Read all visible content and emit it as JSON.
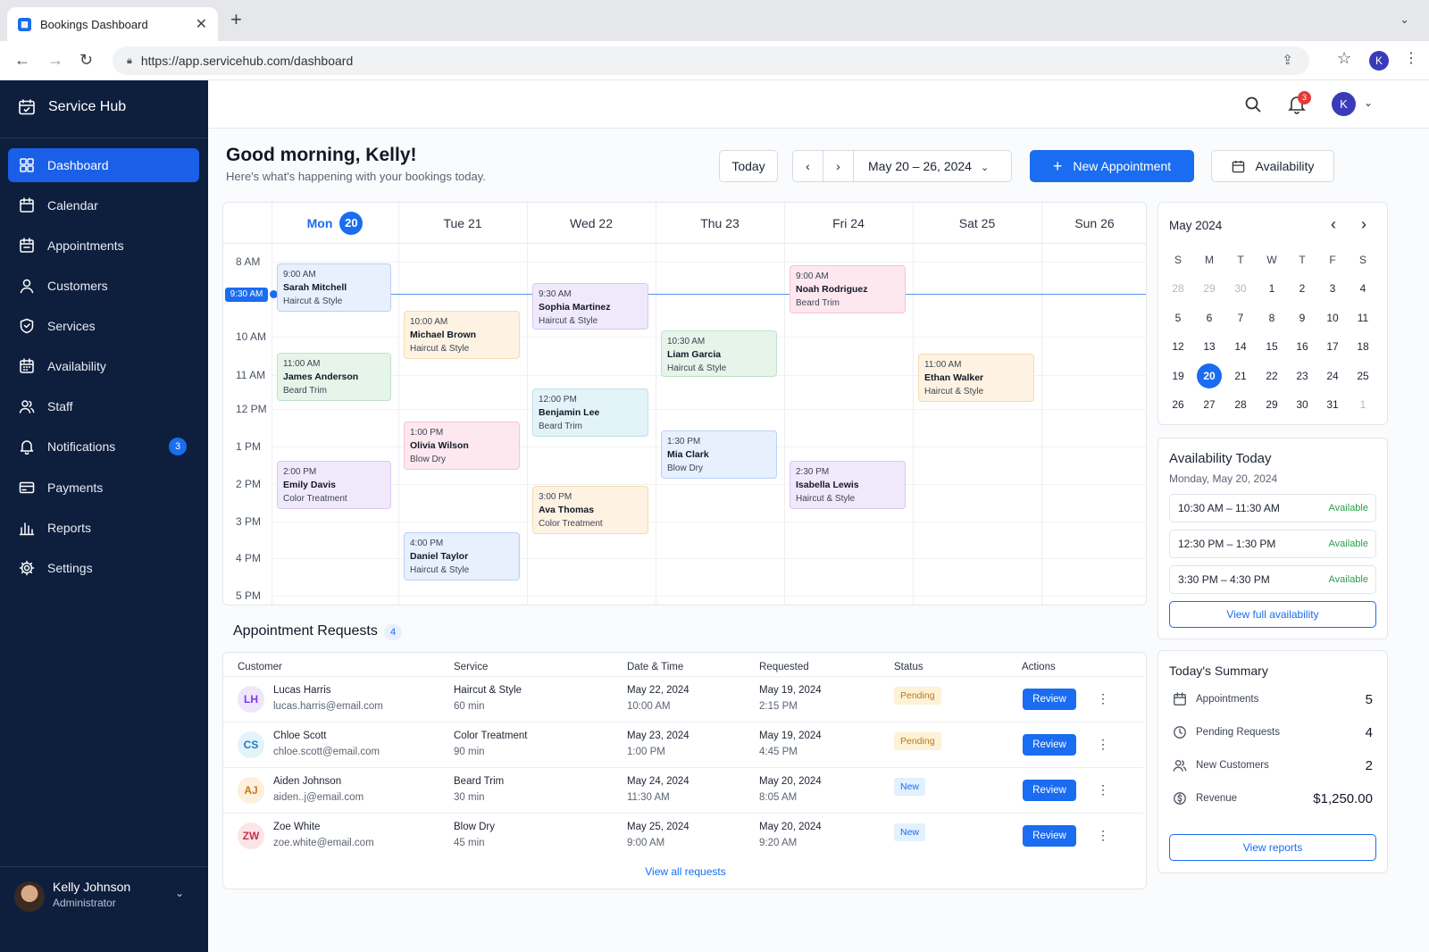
{
  "browser": {
    "tab_title": "Bookings Dashboard",
    "url": "https://app.servicehub.com/dashboard",
    "profile_initial": "K"
  },
  "sidebar": {
    "brand": "Service Hub",
    "items": [
      {
        "label": "Dashboard",
        "icon": "grid-icon"
      },
      {
        "label": "Calendar",
        "icon": "calendar-icon"
      },
      {
        "label": "Appointments",
        "icon": "calendar-check-icon"
      },
      {
        "label": "Customers",
        "icon": "user-icon"
      },
      {
        "label": "Services",
        "icon": "heart-shield-icon"
      },
      {
        "label": "Availability",
        "icon": "calendar-grid-icon"
      },
      {
        "label": "Staff",
        "icon": "users-icon"
      },
      {
        "label": "Notifications",
        "icon": "bell-icon",
        "badge": "3"
      },
      {
        "label": "Payments",
        "icon": "card-icon"
      },
      {
        "label": "Reports",
        "icon": "bar-chart-icon"
      },
      {
        "label": "Settings",
        "icon": "gear-icon"
      }
    ],
    "user": {
      "name": "Kelly Johnson",
      "role": "Administrator"
    }
  },
  "topbar": {
    "notification_count": "3",
    "avatar_initial": "K"
  },
  "header": {
    "greeting": "Good morning, Kelly!",
    "subtitle": "Here's what's happening with your bookings today.",
    "today_label": "Today",
    "range": "May 20 – 26, 2024",
    "new_appointment": "New Appointment",
    "availability": "Availability"
  },
  "calendar": {
    "days": [
      {
        "name": "Mon",
        "num": "20"
      },
      {
        "label": "Tue 21"
      },
      {
        "label": "Wed 22"
      },
      {
        "label": "Thu 23"
      },
      {
        "label": "Fri 24"
      },
      {
        "label": "Sat 25"
      },
      {
        "label": "Sun 26"
      }
    ],
    "times": [
      "8 AM",
      "10 AM",
      "11 AM",
      "12 PM",
      "1 PM",
      "2 PM",
      "3 PM",
      "4 PM",
      "5 PM"
    ],
    "now_label": "9:30 AM",
    "events": [
      {
        "time": "9:00 AM",
        "name": "Sarah Mitchell",
        "service": "Haircut & Style"
      },
      {
        "time": "11:00 AM",
        "name": "James Anderson",
        "service": "Beard Trim"
      },
      {
        "time": "2:00 PM",
        "name": "Emily Davis",
        "service": "Color Treatment"
      },
      {
        "time": "10:00 AM",
        "name": "Michael Brown",
        "service": "Haircut & Style"
      },
      {
        "time": "1:00 PM",
        "name": "Olivia Wilson",
        "service": "Blow Dry"
      },
      {
        "time": "4:00 PM",
        "name": "Daniel Taylor",
        "service": "Haircut & Style"
      },
      {
        "time": "9:30 AM",
        "name": "Sophia Martinez",
        "service": "Haircut & Style"
      },
      {
        "time": "12:00 PM",
        "name": "Benjamin Lee",
        "service": "Beard Trim"
      },
      {
        "time": "3:00 PM",
        "name": "Ava Thomas",
        "service": "Color Treatment"
      },
      {
        "time": "10:30 AM",
        "name": "Liam Garcia",
        "service": "Haircut & Style"
      },
      {
        "time": "1:30 PM",
        "name": "Mia Clark",
        "service": "Blow Dry"
      },
      {
        "time": "9:00 AM",
        "name": "Noah Rodriguez",
        "service": "Beard Trim"
      },
      {
        "time": "2:30 PM",
        "name": "Isabella Lewis",
        "service": "Haircut & Style"
      },
      {
        "time": "11:00 AM",
        "name": "Ethan Walker",
        "service": "Haircut & Style"
      }
    ]
  },
  "colors": {
    "blue": "#e8f0fe",
    "green": "#e6f4ea",
    "orange": "#fef3e2",
    "pink": "#fde8ef",
    "purple": "#efe9fb",
    "teal": "#e3f4f8",
    "accent": "#1a6cf0"
  },
  "mini_calendar": {
    "title": "May 2024",
    "dow": [
      "S",
      "M",
      "T",
      "W",
      "T",
      "F",
      "S"
    ],
    "weeks": [
      [
        "28",
        "29",
        "30",
        "1",
        "2",
        "3",
        "4"
      ],
      [
        "5",
        "6",
        "7",
        "8",
        "9",
        "10",
        "11"
      ],
      [
        "12",
        "13",
        "14",
        "15",
        "16",
        "17",
        "18"
      ],
      [
        "19",
        "20",
        "21",
        "22",
        "23",
        "24",
        "25"
      ],
      [
        "26",
        "27",
        "28",
        "29",
        "30",
        "31",
        "1"
      ]
    ]
  },
  "availability": {
    "title": "Availability Today",
    "date": "Monday, May 20, 2024",
    "slots": [
      {
        "time": "10:30 AM – 11:30 AM",
        "status": "Available"
      },
      {
        "time": "12:30 PM – 1:30 PM",
        "status": "Available"
      },
      {
        "time": "3:30 PM – 4:30 PM",
        "status": "Available"
      }
    ],
    "link": "View full availability"
  },
  "summary": {
    "title": "Today's Summary",
    "rows": [
      {
        "label": "Appointments",
        "value": "5"
      },
      {
        "label": "Pending Requests",
        "value": "4"
      },
      {
        "label": "New Customers",
        "value": "2"
      },
      {
        "label": "Revenue",
        "value": "$1,250.00"
      }
    ],
    "link": "View reports"
  },
  "requests": {
    "title": "Appointment Requests",
    "count": "4",
    "columns": [
      "Customer",
      "Service",
      "Date & Time",
      "Requested",
      "Status",
      "Actions"
    ],
    "rows": [
      {
        "initials": "LH",
        "name": "Lucas Harris",
        "email": "lucas.harris@email.com",
        "service": "Haircut & Style",
        "duration": "60 min",
        "date": "May 22, 2024",
        "time": "10:00 AM",
        "req_date": "May 19, 2024",
        "req_time": "2:15 PM",
        "status": "Pending",
        "action": "Review"
      },
      {
        "initials": "CS",
        "name": "Chloe Scott",
        "email": "chloe.scott@email.com",
        "service": "Color Treatment",
        "duration": "90 min",
        "date": "May 23, 2024",
        "time": "1:00 PM",
        "req_date": "May 19, 2024",
        "req_time": "4:45 PM",
        "status": "Pending",
        "action": "Review"
      },
      {
        "initials": "AJ",
        "name": "Aiden Johnson",
        "email": "aiden..j@email.com",
        "service": "Beard Trim",
        "duration": "30 min",
        "date": "May 24, 2024",
        "time": "11:30 AM",
        "req_date": "May 20, 2024",
        "req_time": "8:05 AM",
        "status": "New",
        "action": "Review"
      },
      {
        "initials": "ZW",
        "name": "Zoe White",
        "email": "zoe.white@email.com",
        "service": "Blow Dry",
        "duration": "45 min",
        "date": "May 25, 2024",
        "time": "9:00 AM",
        "req_date": "May 20, 2024",
        "req_time": "9:20 AM",
        "status": "New",
        "action": "Review"
      }
    ],
    "view_all": "View all requests"
  }
}
